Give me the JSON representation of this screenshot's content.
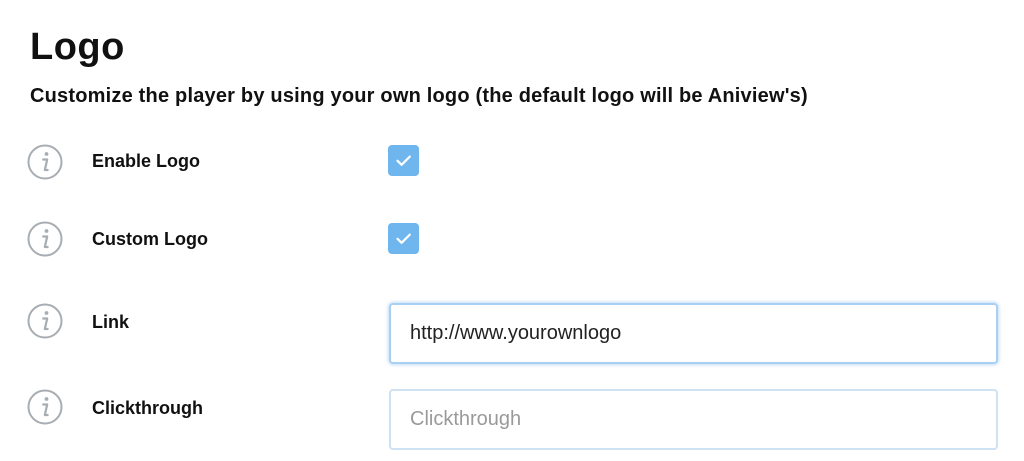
{
  "header": {
    "title": "Logo",
    "subtitle": "Customize the player by using your own logo (the default logo will be Aniview's)"
  },
  "settings": [
    {
      "label": "Enable Logo",
      "control": "checkbox",
      "checked": true,
      "icon": "info-icon"
    },
    {
      "label": "Custom Logo",
      "control": "checkbox",
      "checked": true,
      "icon": "info-icon"
    },
    {
      "label": "Link",
      "control": "text",
      "value": "http://www.yourownlogo",
      "placeholder": "",
      "icon": "info-icon"
    },
    {
      "label": "Clickthrough",
      "control": "text",
      "value": "",
      "placeholder": "Clickthrough",
      "icon": "info-icon"
    }
  ],
  "colors": {
    "checkbox_fill": "#6fb6ee",
    "checkmark": "#ffffff",
    "info_icon": "#a7adb2",
    "field_border": "#cfe2f2"
  }
}
